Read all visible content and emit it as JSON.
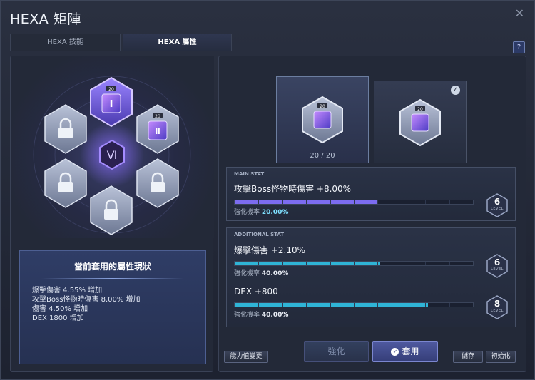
{
  "window": {
    "title": "HEXA 矩陣",
    "close_label": "✕",
    "help_label": "?"
  },
  "tabs": [
    {
      "label": "HEXA 技能",
      "active": false
    },
    {
      "label": "HEXA 屬性",
      "active": true
    }
  ],
  "matrix": {
    "center_label": "Ⅵ",
    "nodes": [
      {
        "state": "active",
        "level": "20",
        "glyph": "I"
      },
      {
        "state": "unlocked",
        "level": "20",
        "glyph": "Ⅱ"
      },
      {
        "state": "locked"
      },
      {
        "state": "locked"
      },
      {
        "state": "locked"
      },
      {
        "state": "locked"
      }
    ]
  },
  "summary": {
    "title": "當前套用的屬性現狀",
    "lines": [
      "爆擊傷害 4.55% 增加",
      "攻擊Boss怪物時傷害 8.00% 增加",
      "傷害 4.50% 增加",
      "DEX 1800 增加"
    ]
  },
  "cards": [
    {
      "level": "20",
      "count": "20 / 20",
      "selected": true,
      "applied": false
    },
    {
      "level": "20",
      "selected": false,
      "applied": true
    }
  ],
  "main_stat": {
    "header": "MAIN STAT",
    "name": "攻擊Boss怪物時傷害 +8.00%",
    "prob_label": "強化機率",
    "prob_value": "20.00%",
    "level": "6",
    "level_label": "LEVEL",
    "progress": 0.6
  },
  "additional_stat": {
    "header": "ADDITIONAL STAT",
    "items": [
      {
        "name": "爆擊傷害 +2.10%",
        "prob_label": "強化機率",
        "prob_value": "40.00%",
        "level": "6",
        "level_label": "LEVEL",
        "progress": 0.61
      },
      {
        "name": "DEX +800",
        "prob_label": "強化機率",
        "prob_value": "40.00%",
        "level": "8",
        "level_label": "LEVEL",
        "progress": 0.81
      }
    ]
  },
  "buttons": {
    "ability_change": "能力值變更",
    "enhance": "強化",
    "apply": "套用",
    "save": "儲存",
    "reset": "初始化"
  },
  "colors": {
    "main_bar": "#7c6cf0",
    "additional_bar": "#2fb4d6",
    "accent": "#9b7cff",
    "prob_highlight": "#7fe0ff"
  }
}
